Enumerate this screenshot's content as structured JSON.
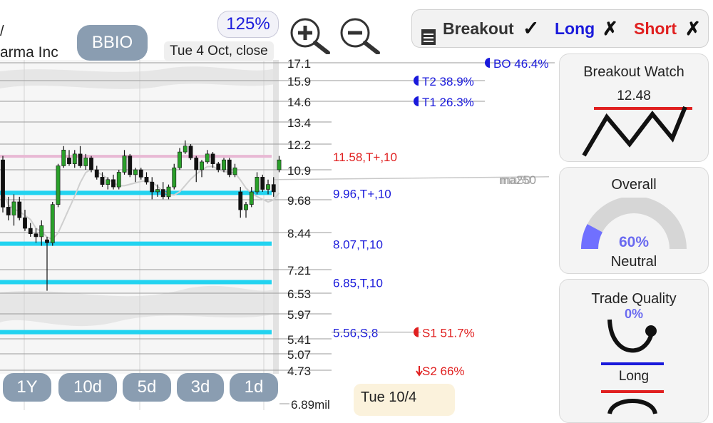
{
  "ticker": "BBIO",
  "company_partial": "arma Inc",
  "company_line1": "/",
  "zoom": "125%",
  "date_label": "Tue 4 Oct, close",
  "date_badge": "Tue 10/4",
  "signals": {
    "breakout": "Breakout",
    "long": "Long",
    "short": "Short",
    "breakout_mark": "✓",
    "long_mark": "✗",
    "short_mark": "✗"
  },
  "periods": [
    "1Y",
    "10d",
    "5d",
    "3d",
    "1d"
  ],
  "panels": {
    "breakout_watch": {
      "title": "Breakout Watch",
      "value": "12.48"
    },
    "overall": {
      "title": "Overall",
      "percent_label": "60%",
      "percent": 60,
      "status": "Neutral"
    },
    "trade_quality": {
      "title": "Trade Quality",
      "percent_label": "0%",
      "label": "Long"
    }
  },
  "colors": {
    "accent_blue": "#1a1adb",
    "accent_red": "#e02020",
    "cyan": "#22d3f0",
    "pink": "#e8b8d4",
    "up": "#2aa02a",
    "down": "#111111"
  },
  "chart_data": {
    "type": "candlestick",
    "y_ticks": [
      "17.1",
      "15.9",
      "14.6",
      "13.4",
      "12.2",
      "10.9",
      "9.68",
      "8.44",
      "7.21",
      "6.53",
      "5.97",
      "5.41",
      "5.07",
      "4.73"
    ],
    "volume_label": "6.89mil",
    "ma_label": "ma250",
    "ma_label_overlap": "ma50",
    "levels": [
      {
        "label": "11.58,T+,10",
        "value": 11.58,
        "color": "#e02020",
        "line": "#e8b8d4"
      },
      {
        "label": "9.96,T+,10",
        "value": 9.96,
        "color": "#1a1adb",
        "line": "#22d3f0"
      },
      {
        "label": "8.07,T,10",
        "value": 8.07,
        "color": "#1a1adb",
        "line": "#22d3f0"
      },
      {
        "label": "6.85,T,10",
        "value": 6.85,
        "color": "#1a1adb",
        "line": "#22d3f0"
      },
      {
        "label": "5.56,S,8",
        "value": 5.56,
        "color": "#1a1adb",
        "line": "#22d3f0"
      }
    ],
    "targets": [
      {
        "label": "BO 46.4%",
        "value": 17.1,
        "color": "#1a1adb"
      },
      {
        "label": "T2 38.9%",
        "value": 15.9,
        "color": "#1a1adb"
      },
      {
        "label": "T1 26.3%",
        "value": 14.6,
        "color": "#1a1adb"
      },
      {
        "label": "S1 51.7%",
        "value": 5.56,
        "color": "#e02020"
      },
      {
        "label": "S2 66%",
        "value": 4.73,
        "color": "#e02020"
      }
    ],
    "candles": [
      {
        "o": 11.4,
        "h": 11.6,
        "l": 9.2,
        "c": 9.4
      },
      {
        "o": 9.4,
        "h": 9.8,
        "l": 8.9,
        "c": 9.1
      },
      {
        "o": 9.1,
        "h": 9.9,
        "l": 8.7,
        "c": 9.6
      },
      {
        "o": 9.6,
        "h": 9.8,
        "l": 8.9,
        "c": 9.0
      },
      {
        "o": 9.0,
        "h": 9.3,
        "l": 8.5,
        "c": 8.6
      },
      {
        "o": 8.6,
        "h": 8.8,
        "l": 8.3,
        "c": 8.4
      },
      {
        "o": 8.4,
        "h": 8.6,
        "l": 8.1,
        "c": 8.3
      },
      {
        "o": 8.3,
        "h": 8.9,
        "l": 8.0,
        "c": 8.7
      },
      {
        "o": 8.2,
        "h": 8.3,
        "l": 6.6,
        "c": 8.1
      },
      {
        "o": 8.1,
        "h": 9.6,
        "l": 8.0,
        "c": 9.5
      },
      {
        "o": 9.5,
        "h": 11.2,
        "l": 9.4,
        "c": 11.1
      },
      {
        "o": 11.1,
        "h": 12.1,
        "l": 11.0,
        "c": 11.9
      },
      {
        "o": 11.5,
        "h": 11.9,
        "l": 11.1,
        "c": 11.2
      },
      {
        "o": 11.2,
        "h": 11.9,
        "l": 11.0,
        "c": 11.7
      },
      {
        "o": 11.7,
        "h": 12.1,
        "l": 11.0,
        "c": 11.1
      },
      {
        "o": 11.1,
        "h": 11.7,
        "l": 10.9,
        "c": 11.5
      },
      {
        "o": 11.5,
        "h": 11.6,
        "l": 10.8,
        "c": 10.9
      },
      {
        "o": 10.9,
        "h": 11.1,
        "l": 10.5,
        "c": 10.6
      },
      {
        "o": 10.6,
        "h": 10.8,
        "l": 10.2,
        "c": 10.3
      },
      {
        "o": 10.3,
        "h": 10.6,
        "l": 10.1,
        "c": 10.5
      },
      {
        "o": 10.5,
        "h": 10.7,
        "l": 10.1,
        "c": 10.2
      },
      {
        "o": 10.2,
        "h": 10.9,
        "l": 10.1,
        "c": 10.8
      },
      {
        "o": 10.8,
        "h": 11.9,
        "l": 10.7,
        "c": 11.6
      },
      {
        "o": 11.6,
        "h": 11.7,
        "l": 10.6,
        "c": 10.7
      },
      {
        "o": 10.7,
        "h": 11.0,
        "l": 10.4,
        "c": 10.9
      },
      {
        "o": 10.9,
        "h": 11.0,
        "l": 10.5,
        "c": 10.6
      },
      {
        "o": 10.6,
        "h": 10.8,
        "l": 10.3,
        "c": 10.4
      },
      {
        "o": 10.4,
        "h": 10.6,
        "l": 9.7,
        "c": 10.0
      },
      {
        "o": 10.0,
        "h": 10.3,
        "l": 9.8,
        "c": 10.1
      },
      {
        "o": 10.1,
        "h": 10.4,
        "l": 9.7,
        "c": 9.8
      },
      {
        "o": 9.8,
        "h": 10.3,
        "l": 9.7,
        "c": 10.2
      },
      {
        "o": 10.2,
        "h": 11.2,
        "l": 10.1,
        "c": 11.0
      },
      {
        "o": 11.0,
        "h": 12.0,
        "l": 10.9,
        "c": 11.8
      },
      {
        "o": 11.8,
        "h": 12.4,
        "l": 11.7,
        "c": 12.1
      },
      {
        "o": 12.1,
        "h": 12.2,
        "l": 11.4,
        "c": 11.5
      },
      {
        "o": 11.5,
        "h": 11.6,
        "l": 10.4,
        "c": 10.9
      },
      {
        "o": 10.9,
        "h": 11.4,
        "l": 10.6,
        "c": 11.3
      },
      {
        "o": 11.3,
        "h": 11.9,
        "l": 11.2,
        "c": 11.7
      },
      {
        "o": 11.7,
        "h": 11.8,
        "l": 11.0,
        "c": 11.2
      },
      {
        "o": 11.2,
        "h": 11.3,
        "l": 10.8,
        "c": 10.9
      },
      {
        "o": 10.9,
        "h": 11.5,
        "l": 10.8,
        "c": 11.4
      },
      {
        "o": 11.4,
        "h": 11.5,
        "l": 10.6,
        "c": 10.7
      },
      {
        "o": 10.7,
        "h": 11.2,
        "l": 10.6,
        "c": 11.0
      },
      {
        "o": 10.0,
        "h": 10.2,
        "l": 9.0,
        "c": 9.3
      },
      {
        "o": 9.3,
        "h": 9.6,
        "l": 9.0,
        "c": 9.5
      },
      {
        "o": 9.5,
        "h": 10.2,
        "l": 9.4,
        "c": 10.0
      },
      {
        "o": 10.0,
        "h": 10.8,
        "l": 9.9,
        "c": 10.6
      },
      {
        "o": 10.6,
        "h": 10.7,
        "l": 10.0,
        "c": 10.1
      },
      {
        "o": 10.1,
        "h": 10.5,
        "l": 9.9,
        "c": 10.3
      },
      {
        "o": 10.3,
        "h": 10.6,
        "l": 9.8,
        "c": 10.0
      },
      {
        "o": 10.9,
        "h": 11.6,
        "l": 10.8,
        "c": 11.4
      }
    ]
  }
}
